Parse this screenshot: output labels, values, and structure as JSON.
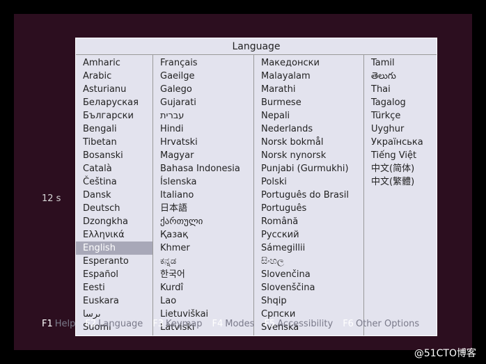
{
  "title": "Language",
  "countdown": "12 s",
  "selected": "English",
  "columns": [
    [
      "Amharic",
      "Arabic",
      "Asturianu",
      "Беларуская",
      "Български",
      "Bengali",
      "Tibetan",
      "Bosanski",
      "Català",
      "Čeština",
      "Dansk",
      "Deutsch",
      "Dzongkha",
      "Ελληνικά",
      "English",
      "Esperanto",
      "Español",
      "Eesti",
      "Euskara",
      "ىرسا",
      "Suomi"
    ],
    [
      "Français",
      "Gaeilge",
      "Galego",
      "Gujarati",
      "עברית",
      "Hindi",
      "Hrvatski",
      "Magyar",
      "Bahasa Indonesia",
      "Íslenska",
      "Italiano",
      "日本語",
      "ქართული",
      "Қазақ",
      "Khmer",
      "ಕನ್ನಡ",
      "한국어",
      "Kurdî",
      "Lao",
      "Lietuviškai",
      "Latviski"
    ],
    [
      "Македонски",
      "Malayalam",
      "Marathi",
      "Burmese",
      "Nepali",
      "Nederlands",
      "Norsk bokmål",
      "Norsk nynorsk",
      "Punjabi (Gurmukhi)",
      "Polski",
      "Português do Brasil",
      "Português",
      "Română",
      "Русский",
      "Sámegillii",
      "සිංහල",
      "Slovenčina",
      "Slovenščina",
      "Shqip",
      "Српски",
      "Svenska"
    ],
    [
      "Tamil",
      "తెలుగు",
      "Thai",
      "Tagalog",
      "Türkçe",
      "Uyghur",
      "Українська",
      "Tiếng Việt",
      "中文(简体)",
      "中文(繁體)"
    ]
  ],
  "footer": [
    {
      "key": "F1",
      "label": "Help"
    },
    {
      "key": "F2",
      "label": "Language"
    },
    {
      "key": "F3",
      "label": "Keymap"
    },
    {
      "key": "F4",
      "label": "Modes"
    },
    {
      "key": "F5",
      "label": "Accessibility"
    },
    {
      "key": "F6",
      "label": "Other Options"
    }
  ],
  "watermark": "@51CTO博客"
}
